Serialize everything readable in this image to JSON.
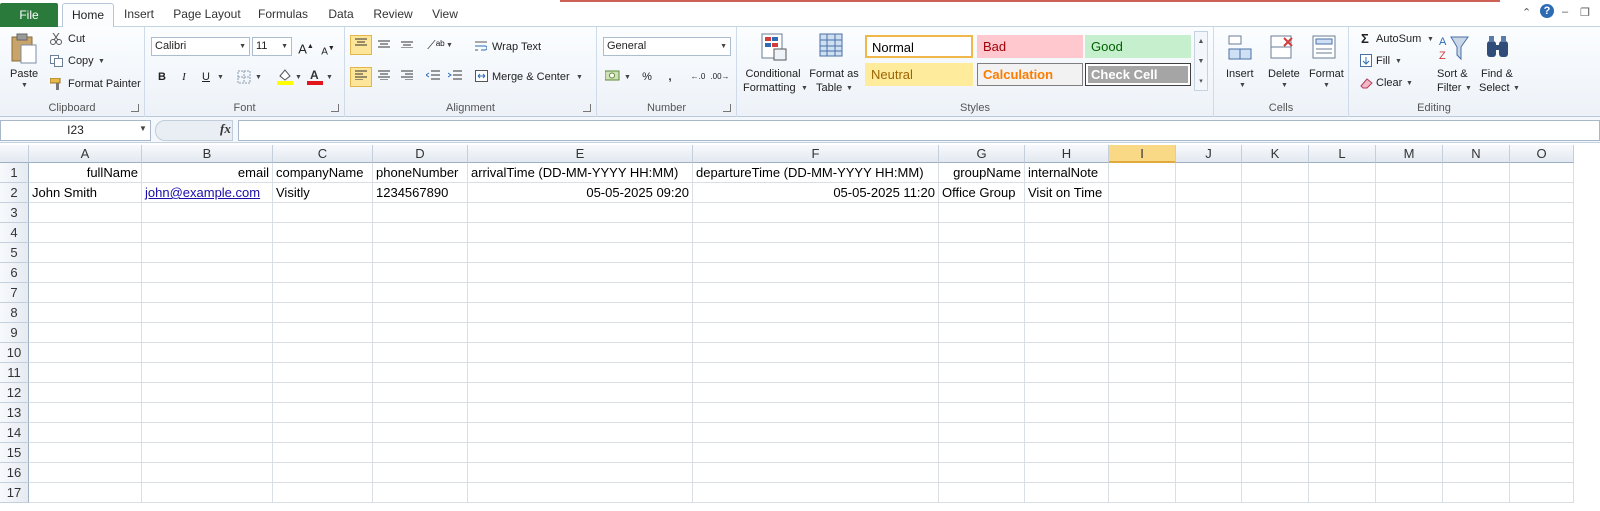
{
  "tabs": [
    "File",
    "Home",
    "Insert",
    "Page Layout",
    "Formulas",
    "Data",
    "Review",
    "View"
  ],
  "clipboard": {
    "paste": "Paste",
    "cut": "Cut",
    "copy": "Copy",
    "format_painter": "Format Painter",
    "label": "Clipboard"
  },
  "font": {
    "name": "Calibri",
    "size": "11",
    "label": "Font",
    "bold": "B",
    "italic": "I",
    "underline": "U",
    "grow": "A",
    "shrink": "A"
  },
  "alignment": {
    "wrap": "Wrap Text",
    "merge": "Merge & Center",
    "label": "Alignment"
  },
  "number": {
    "format": "General",
    "percent": "%",
    "comma": ",",
    "label": "Number"
  },
  "styles": {
    "conditional": [
      "Conditional",
      "Formatting"
    ],
    "format_table": [
      "Format as",
      "Table"
    ],
    "cells": [
      {
        "text": "Normal",
        "bg": "#ffffff",
        "fg": "#000000",
        "border": "#f0b74b"
      },
      {
        "text": "Bad",
        "bg": "#ffc7ce",
        "fg": "#9c0006",
        "border": "#ffc7ce"
      },
      {
        "text": "Good",
        "bg": "#c6efce",
        "fg": "#006100",
        "border": "#c6efce"
      },
      {
        "text": "Neutral",
        "bg": "#ffeb9c",
        "fg": "#9c6500",
        "border": "#ffeb9c"
      },
      {
        "text": "Calculation",
        "bg": "#f2f2f2",
        "fg": "#fa7d00",
        "border": "#7f7f7f"
      },
      {
        "text": "Check Cell",
        "bg": "#a5a5a5",
        "fg": "#ffffff",
        "border": "#3f3f3f"
      }
    ],
    "label": "Styles"
  },
  "cells_group": {
    "insert": "Insert",
    "delete": "Delete",
    "format": "Format",
    "label": "Cells"
  },
  "editing": {
    "autosum": "AutoSum",
    "fill": "Fill",
    "clear": "Clear",
    "sort": [
      "Sort &",
      "Filter"
    ],
    "find": [
      "Find &",
      "Select"
    ],
    "label": "Editing"
  },
  "formula_bar": {
    "name_box": "I23",
    "fx": "fx",
    "content": ""
  },
  "grid": {
    "columns": [
      "A",
      "B",
      "C",
      "D",
      "E",
      "F",
      "G",
      "H",
      "I",
      "J",
      "K",
      "L",
      "M",
      "N",
      "O"
    ],
    "selected_column": "I",
    "rows": [
      "1",
      "2",
      "3",
      "4",
      "5",
      "6",
      "7",
      "8",
      "9",
      "10",
      "11",
      "12",
      "13",
      "14",
      "15",
      "16",
      "17"
    ],
    "data": [
      [
        "fullName",
        "email",
        "companyName",
        "phoneNumber",
        "arrivalTime (DD-MM-YYYY HH:MM)",
        "departureTime (DD-MM-YYYY HH:MM)",
        "groupName",
        "internalNote"
      ],
      [
        "John Smith",
        "john@example.com",
        "Visitly",
        "1234567890",
        "05-05-2025 09:20",
        "05-05-2025 11:20",
        "Office Group",
        "Visit on Time"
      ]
    ]
  }
}
